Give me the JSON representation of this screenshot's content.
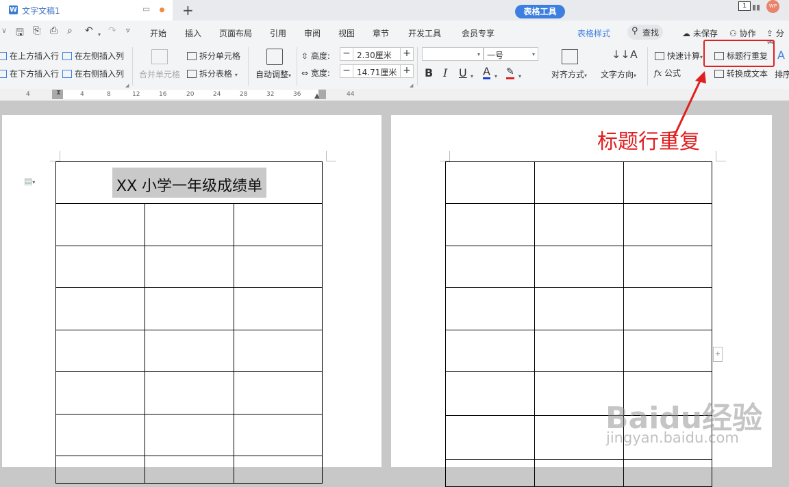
{
  "tabbar": {
    "doc_title": "文字文稿1",
    "app_letter": "W",
    "new_tab": "+",
    "window_count": "1",
    "user_initials": "WP"
  },
  "menubar": {
    "items": [
      "开始",
      "插入",
      "页面布局",
      "引用",
      "审阅",
      "视图",
      "章节",
      "开发工具",
      "会员专享"
    ],
    "active": "表格工具",
    "style_tab": "表格样式",
    "find": "查找",
    "unsaved": "未保存",
    "collab": "协作",
    "share": "分享"
  },
  "ribbon": {
    "insert_above": "在上方插入行",
    "insert_below": "在下方插入行",
    "insert_left": "在左侧插入列",
    "insert_right": "在右侧插入列",
    "merge_cells": "合并单元格",
    "split_cells": "拆分单元格",
    "split_table": "拆分表格",
    "auto_fit": "自动调整",
    "height_label": "高度:",
    "height_value": "2.30厘米",
    "width_label": "宽度:",
    "width_value": "14.71厘米",
    "font_name": "",
    "font_size": "一号",
    "align": "对齐方式",
    "text_direction": "文字方向",
    "quick_calc": "快速计算",
    "formula": "公式",
    "repeat_header": "标题行重复",
    "convert_text": "转换成文本",
    "sort": "排序",
    "minus": "−",
    "plus": "+",
    "bold": "B",
    "italic": "I",
    "underline": "U",
    "font_color": "A",
    "fx": "fx"
  },
  "ruler": {
    "ticks": [
      "4",
      "4",
      "8",
      "12",
      "16",
      "20",
      "24",
      "28",
      "32",
      "36",
      "44"
    ]
  },
  "document": {
    "table_title": "XX 小学一年级成绩单"
  },
  "annotation": "标题行重复",
  "watermark": {
    "brand": "Baidu经验",
    "url": "jingyan.baidu.com"
  },
  "colors": {
    "accent": "#3d7fe0",
    "annotation": "#e02020",
    "highlight_bg": "#c9c9c9"
  }
}
